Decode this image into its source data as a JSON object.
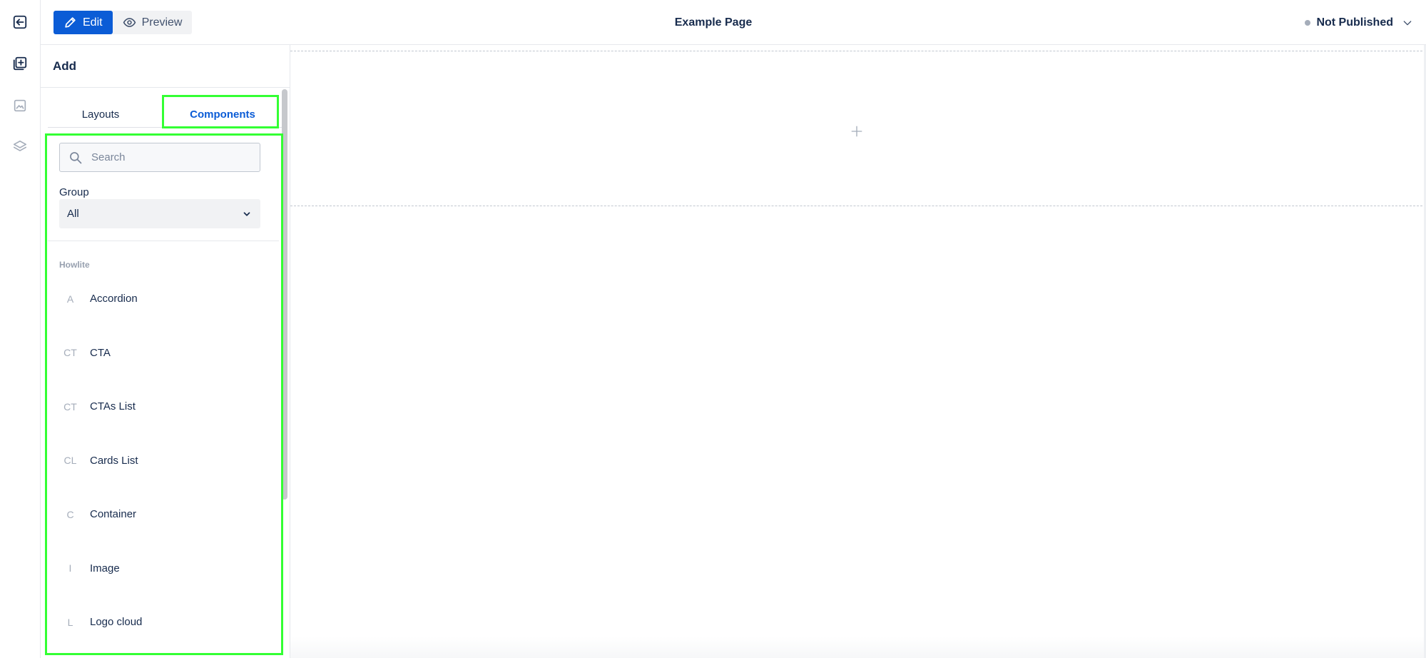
{
  "rail": {
    "items": [
      {
        "icon": "exit-icon"
      },
      {
        "icon": "add-content-icon",
        "active": true
      },
      {
        "icon": "image-icon"
      },
      {
        "icon": "layers-icon"
      }
    ]
  },
  "header": {
    "edit_label": "Edit",
    "preview_label": "Preview",
    "page_title": "Example Page",
    "status_label": "Not Published"
  },
  "sidebar": {
    "title": "Add",
    "tabs": [
      {
        "label": "Layouts",
        "active": false
      },
      {
        "label": "Components",
        "active": true
      }
    ],
    "search": {
      "placeholder": "Search",
      "value": ""
    },
    "group": {
      "label": "Group",
      "selected": "All"
    },
    "section_title": "Howlite",
    "components": [
      {
        "abbr": "A",
        "label": "Accordion"
      },
      {
        "abbr": "CT",
        "label": "CTA"
      },
      {
        "abbr": "CT",
        "label": "CTAs List"
      },
      {
        "abbr": "CL",
        "label": "Cards List"
      },
      {
        "abbr": "C",
        "label": "Container"
      },
      {
        "abbr": "I",
        "label": "Image"
      },
      {
        "abbr": "L",
        "label": "Logo cloud"
      }
    ]
  },
  "colors": {
    "accent": "#0b5cd6",
    "highlight": "#33ff33",
    "status_dot": "#a5adba"
  }
}
